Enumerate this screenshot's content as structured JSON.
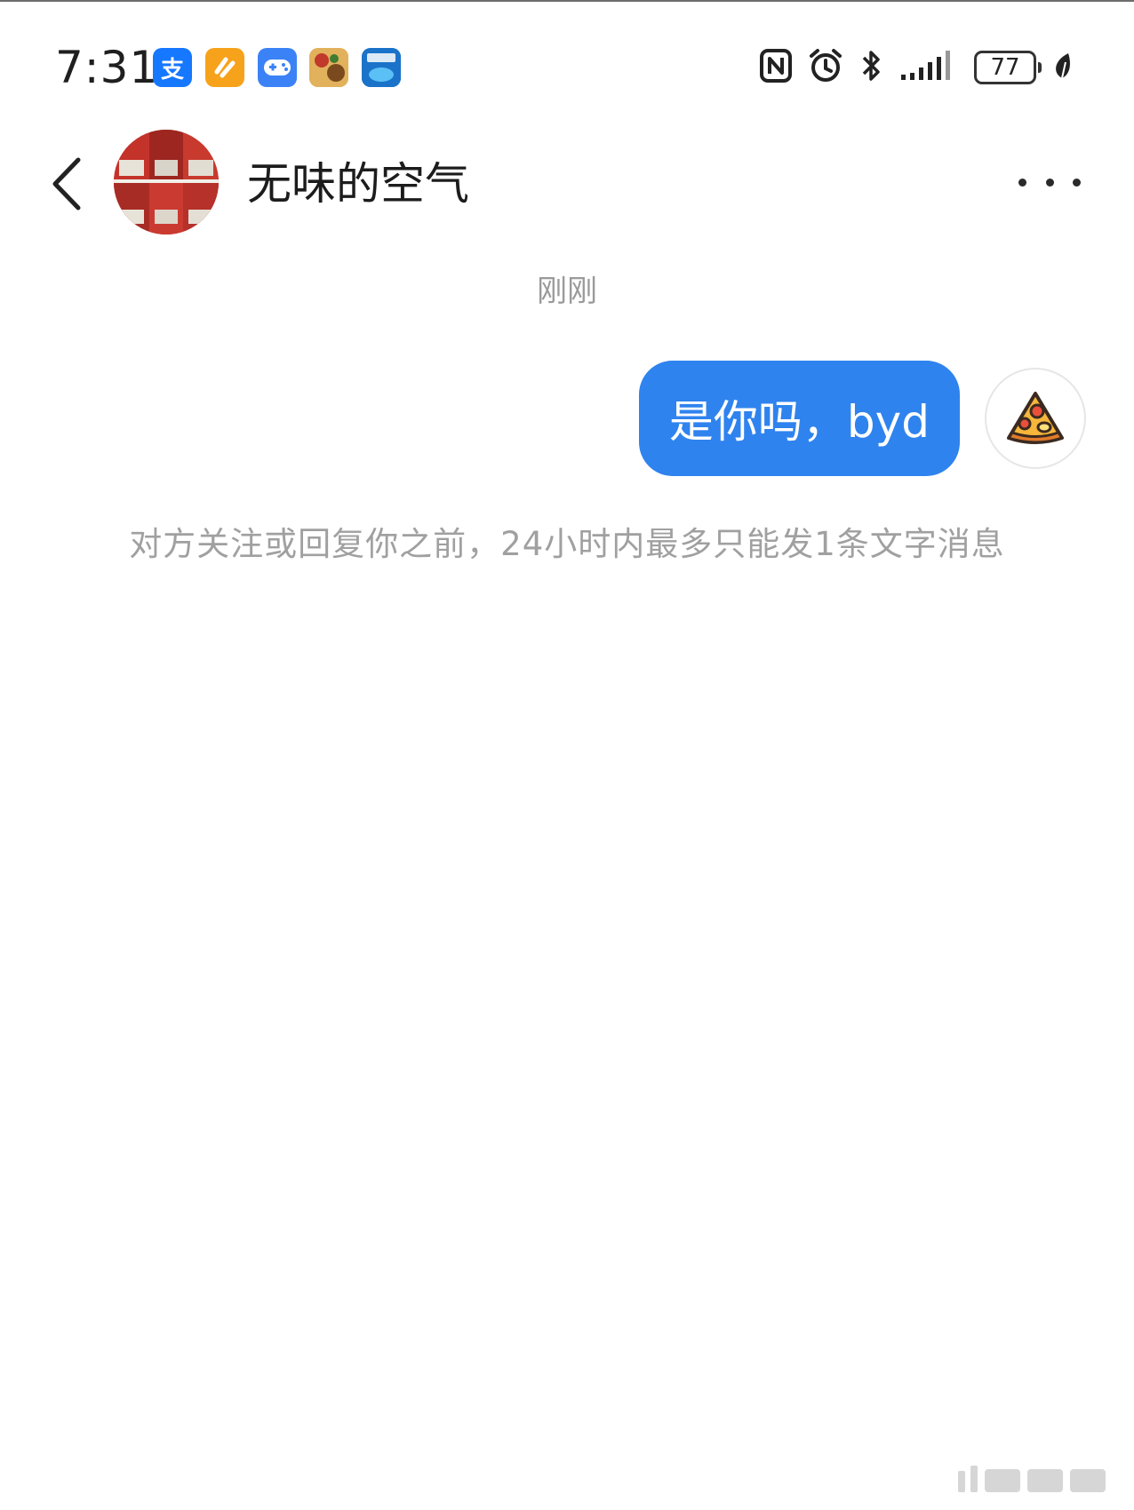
{
  "status_bar": {
    "time": "7:31",
    "battery_level": "77",
    "notification_icons": [
      "alipay-icon",
      "orange-app-icon",
      "game-controller-icon",
      "game-app-icon",
      "blue-app-icon"
    ],
    "alipay_glyph": "支",
    "system_icons": [
      "nfc-icon",
      "alarm-icon",
      "bluetooth-icon",
      "signal-icon",
      "battery-icon",
      "power-saving-leaf-icon"
    ]
  },
  "header": {
    "contact_name": "无味的空气",
    "back_icon": "chevron-left-icon",
    "more_icon": "more-dots-icon"
  },
  "chat": {
    "timestamp": "刚刚",
    "messages": [
      {
        "text": "是你吗，byd",
        "sender": "self"
      }
    ],
    "self_avatar_icon": "pizza-icon",
    "limit_notice": "对方关注或回复你之前，24小时内最多只能发1条文字消息"
  },
  "colors": {
    "bubble": "#2f83ee",
    "notice_text": "#a0a0a0",
    "timestamp_text": "#9a9a9a"
  }
}
